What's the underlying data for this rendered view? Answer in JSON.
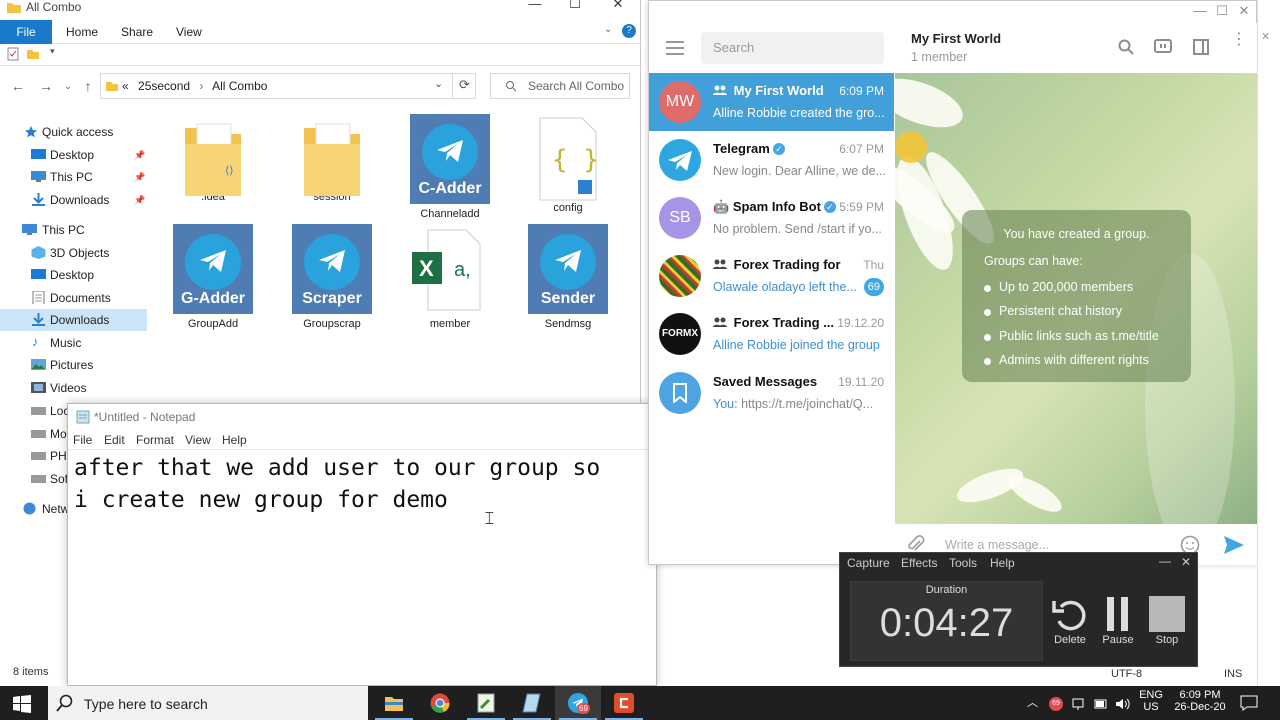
{
  "explorer": {
    "title": "All Combo",
    "tabs": [
      "File",
      "Home",
      "Share",
      "View"
    ],
    "address": {
      "prefix": "«",
      "crumbs": [
        "25second",
        "All Combo"
      ]
    },
    "search_placeholder": "Search All Combo",
    "quick_access_label": "Quick access",
    "sidebar": [
      {
        "label": "Desktop",
        "pinned": true
      },
      {
        "label": "This PC",
        "pinned": true
      },
      {
        "label": "Downloads",
        "pinned": true
      },
      {
        "label": "This PC",
        "pinned": false
      },
      {
        "label": "3D Objects",
        "pinned": false
      },
      {
        "label": "Desktop",
        "pinned": false
      },
      {
        "label": "Documents",
        "pinned": false
      },
      {
        "label": "Downloads",
        "pinned": false,
        "selected": true
      },
      {
        "label": "Music",
        "pinned": false
      },
      {
        "label": "Pictures",
        "pinned": false
      },
      {
        "label": "Videos",
        "pinned": false
      },
      {
        "label": "Loc",
        "pinned": false
      },
      {
        "label": "Mo",
        "pinned": false
      },
      {
        "label": "PH",
        "pinned": false
      },
      {
        "label": "Sof",
        "pinned": false
      },
      {
        "label": "Netw",
        "pinned": false
      }
    ],
    "files": [
      {
        "name": ".idea",
        "icon": "folder-icon"
      },
      {
        "name": "session",
        "icon": "folder-icon"
      },
      {
        "name": "Channeladd",
        "icon": "telegram-icon",
        "tile": "C-Adder"
      },
      {
        "name": "config",
        "icon": "json-file-icon",
        "tile": "{ }"
      },
      {
        "name": "GroupAdd",
        "icon": "telegram-icon",
        "tile": "G-Adder"
      },
      {
        "name": "Groupscrap",
        "icon": "telegram-icon",
        "tile": "Scraper"
      },
      {
        "name": "member",
        "icon": "excel-csv-icon",
        "tile": "X"
      },
      {
        "name": "Sendmsg",
        "icon": "telegram-icon",
        "tile": "Sender"
      }
    ],
    "status": "8 items"
  },
  "notepad": {
    "title": "*Untitled - Notepad",
    "menu": [
      "File",
      "Edit",
      "Format",
      "View",
      "Help"
    ],
    "content": "after that we add user to our group so\ni create new group for demo"
  },
  "telegram": {
    "search_placeholder": "Search",
    "chats": [
      {
        "name": "My First World",
        "time": "6:09 PM",
        "message": "Alline Robbie created the gro...",
        "avatar_text": "MW",
        "avatar_color": "#e06b6b",
        "selected": true,
        "group": true
      },
      {
        "name": "Telegram",
        "time": "6:07 PM",
        "message": "New login. Dear Alline, we de...",
        "avatar_color": "#2ea6e0",
        "verified": true
      },
      {
        "name": "Spam Info Bot",
        "time": "5:59 PM",
        "message": "No problem. Send /start if yo...",
        "avatar_text": "SB",
        "avatar_color": "#a695e7",
        "verified": true,
        "bot": true
      },
      {
        "name": "Forex Trading for B...",
        "time": "Thu",
        "message": "Olawale oladayo left the...",
        "avatar_color": "#3e7b2e",
        "badge": "69",
        "group": true,
        "link_msg": true
      },
      {
        "name": "Forex Trading ...",
        "time": "19.12.20",
        "message": "Alline Robbie joined the group",
        "avatar_text": "FORMX",
        "avatar_color": "#111111",
        "group": true,
        "link_msg": true
      },
      {
        "name": "Saved Messages",
        "time": "19.11.20",
        "message_prefix": "You:",
        "message": "https://t.me/joinchat/Q...",
        "avatar_color": "#4ea4e0"
      }
    ],
    "active_chat": {
      "title": "My First World",
      "subtitle": "1 member"
    },
    "info_card": {
      "title": "You have created a group.",
      "subtitle": "Groups can have:",
      "items": [
        "Up to 200,000 members",
        "Persistent chat history",
        "Public links such as t.me/title",
        "Admins with different rights"
      ]
    },
    "input_placeholder": "Write a message..."
  },
  "capture": {
    "menu": [
      "Capture",
      "Effects",
      "Tools",
      "Help"
    ],
    "duration_label": "Duration",
    "time": "0:04:27",
    "buttons": [
      "Delete",
      "Pause",
      "Stop"
    ]
  },
  "statusbar_extra": {
    "encoding": "UTF-8",
    "mode": "INS"
  },
  "taskbar": {
    "search_text": "Type here to search",
    "telegram_badge": "69",
    "language": "ENG",
    "region": "US",
    "time": "6:09 PM",
    "date": "26-Dec-20"
  }
}
